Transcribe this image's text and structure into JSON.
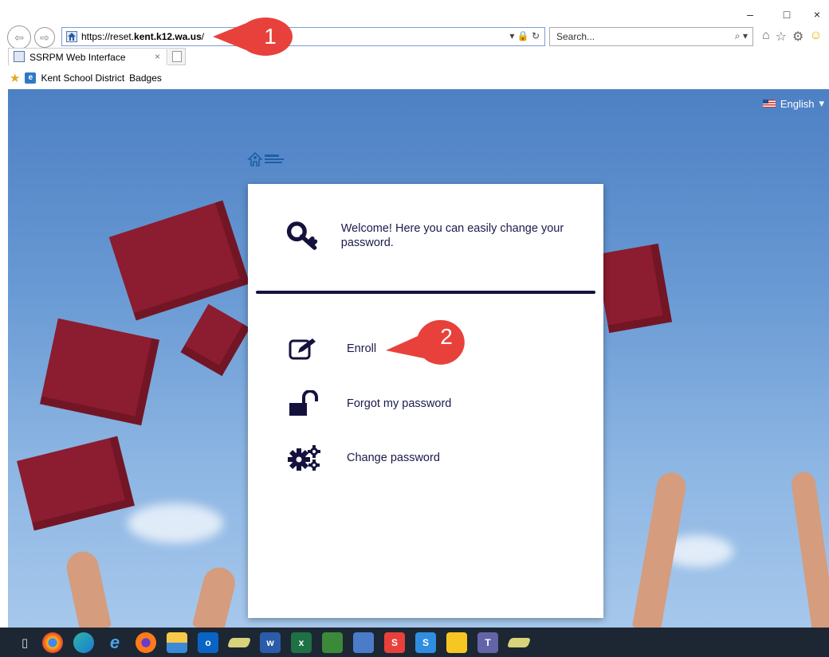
{
  "window": {
    "minimize": "–",
    "maximize": "□",
    "close": "×"
  },
  "nav": {
    "back": "⇦",
    "forward": "⇨"
  },
  "address": {
    "url_prefix": "https://reset.",
    "url_domain": "kent.k12.wa.us",
    "url_suffix": "/",
    "tools": "▾ 🔒 ↻"
  },
  "search": {
    "placeholder": "Search...",
    "tools": "⌕ ▾"
  },
  "browser_icons": [
    "⌂",
    "☆",
    "⚙",
    "☺"
  ],
  "tab": {
    "title": "SSRPM Web Interface",
    "close": "×"
  },
  "favorites": {
    "item": "Kent School District",
    "item2": "Badges"
  },
  "page": {
    "language": "English",
    "language_caret": "▾",
    "welcome": "Welcome! Here you can easily change your password.",
    "menu": [
      {
        "label": "Enroll"
      },
      {
        "label": "Forgot my password"
      },
      {
        "label": "Change password"
      }
    ]
  },
  "callouts": [
    "1",
    "2"
  ],
  "colors": {
    "accent": "#14123d",
    "callout": "#e8413b",
    "taskbar": "#1c2733"
  }
}
